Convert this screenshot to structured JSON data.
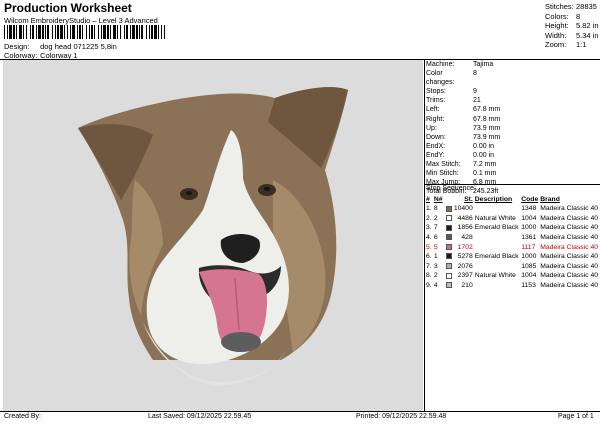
{
  "header": {
    "title": "Production Worksheet",
    "subtitle": "Wilcom EmbroideryStudio – Level 3 Advanced",
    "design_label": "Design:",
    "design_value": "dog head 071225 5,8in",
    "colorway_label": "Colorway:",
    "colorway_value": "Colorway 1"
  },
  "top_stats": [
    {
      "label": "Stitches:",
      "value": "28835"
    },
    {
      "label": "Colors:",
      "value": "8"
    },
    {
      "label": "Height:",
      "value": "5.82 in"
    },
    {
      "label": "Width:",
      "value": "5.34 in"
    },
    {
      "label": "Zoom:",
      "value": "1:1"
    }
  ],
  "machine_info": [
    {
      "label": "Machine:",
      "value": "Tajima"
    },
    {
      "label": "Color changes:",
      "value": "8"
    },
    {
      "label": "Stops:",
      "value": "9"
    },
    {
      "label": "Trims:",
      "value": "21"
    },
    {
      "label": "Left:",
      "value": "67.8 mm"
    },
    {
      "label": "Right:",
      "value": "67.8 mm"
    },
    {
      "label": "Up:",
      "value": "73.9 mm"
    },
    {
      "label": "Down:",
      "value": "73.9 mm"
    },
    {
      "label": "EndX:",
      "value": "0.00 in"
    },
    {
      "label": "EndY:",
      "value": "0.00 in"
    },
    {
      "label": "Max Stitch:",
      "value": "7.2 mm"
    },
    {
      "label": "Min Stitch:",
      "value": "0.1 mm"
    },
    {
      "label": "Max Jump:",
      "value": "6.8 mm"
    },
    {
      "label": "Total Bobbin:",
      "value": "245.23ft"
    }
  ],
  "stop_sequence": {
    "label": "Stop Sequence:",
    "headers": {
      "num": "#",
      "n": "N#",
      "st": "St.",
      "description": "Description",
      "code": "Code",
      "brand": "Brand"
    },
    "rows": [
      {
        "num": "1.",
        "n": "8",
        "color": "#8a6a4a",
        "st": "10400",
        "description": "",
        "code": "1348",
        "brand": "Madeira Classic 40",
        "red": false
      },
      {
        "num": "2.",
        "n": "2",
        "color": "#ffffff",
        "st": "4486",
        "description": "Natural White",
        "code": "1004",
        "brand": "Madeira Classic 40",
        "red": false
      },
      {
        "num": "3.",
        "n": "7",
        "color": "#1c1c1c",
        "st": "1856",
        "description": "Emerald Black",
        "code": "1000",
        "brand": "Madeira Classic 40",
        "red": false
      },
      {
        "num": "4.",
        "n": "6",
        "color": "#5a5a5a",
        "st": "428",
        "description": "",
        "code": "1361",
        "brand": "Madeira Classic 40",
        "red": false
      },
      {
        "num": "5.",
        "n": "5",
        "color": "#c97088",
        "st": "1702",
        "description": "",
        "code": "1117",
        "brand": "Madeira Classic 40",
        "red": true
      },
      {
        "num": "6.",
        "n": "1",
        "color": "#1c1c1c",
        "st": "5278",
        "description": "Emerald Black",
        "code": "1000",
        "brand": "Madeira Classic 40",
        "red": false
      },
      {
        "num": "7.",
        "n": "3",
        "color": "#b5b0a6",
        "st": "2076",
        "description": "",
        "code": "1085",
        "brand": "Madeira Classic 40",
        "red": false
      },
      {
        "num": "8.",
        "n": "2",
        "color": "#ffffff",
        "st": "2397",
        "description": "Natural White",
        "code": "1004",
        "brand": "Madeira Classic 40",
        "red": false
      },
      {
        "num": "9.",
        "n": "4",
        "color": "#a8c7bd",
        "st": "210",
        "description": "",
        "code": "1153",
        "brand": "Madeira Classic 40",
        "red": false
      }
    ]
  },
  "footer": {
    "created_by": "Created By:",
    "last_saved": "Last Saved: 09/12/2025 22.59.45",
    "printed": "Printed: 09/12/2025 22.59.48",
    "page": "Page 1 of 1"
  }
}
